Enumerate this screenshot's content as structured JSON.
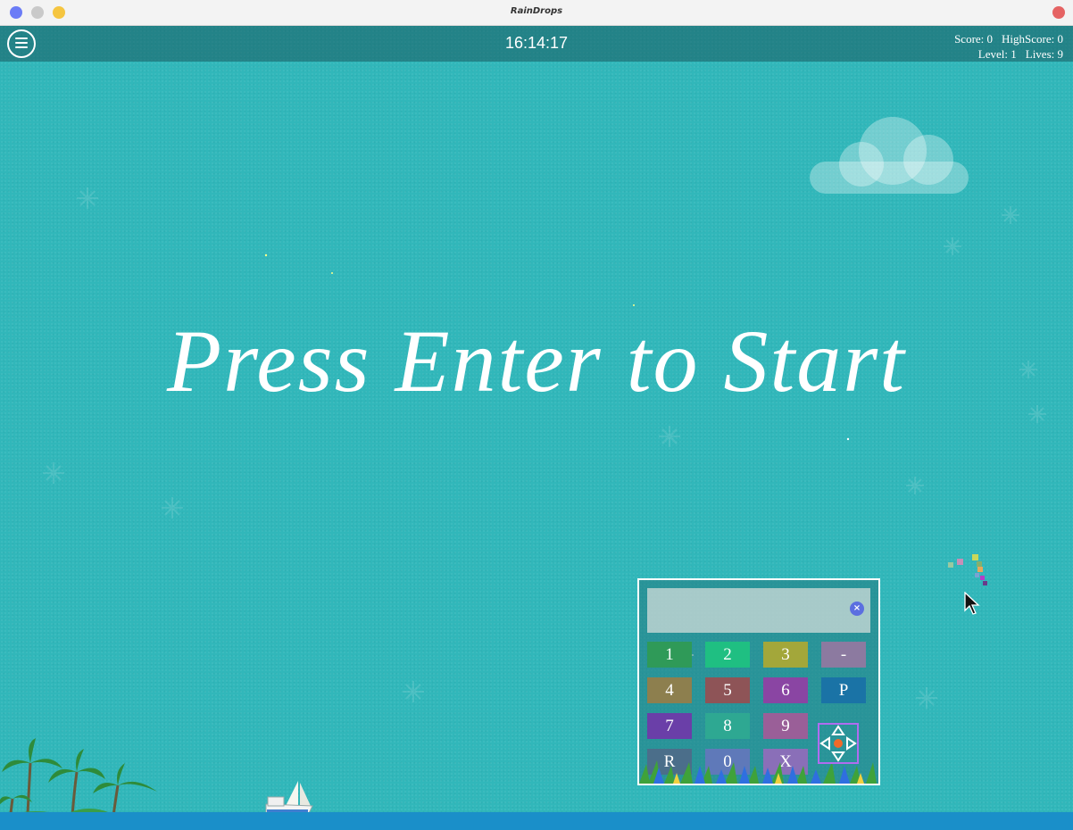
{
  "window": {
    "title": "RainDrops"
  },
  "hud": {
    "clock": "16:14:17",
    "score_label": "Score: 0",
    "highscore_label": "HighScore: 0",
    "level_label": "Level: 1",
    "lives_label": "Lives: 9"
  },
  "headline": "Press Enter to Start",
  "keypad": {
    "keys": [
      {
        "label": "1",
        "color": "#2f9a58"
      },
      {
        "label": "2",
        "color": "#1fbf82"
      },
      {
        "label": "3",
        "color": "#a3a73a"
      },
      {
        "label": "-",
        "color": "#8c7aa0"
      },
      {
        "label": "4",
        "color": "#8d7f4e"
      },
      {
        "label": "5",
        "color": "#8e5457"
      },
      {
        "label": "6",
        "color": "#8a45a3"
      },
      {
        "label": "P",
        "color": "#1a73a6"
      },
      {
        "label": "7",
        "color": "#6a3fa8"
      },
      {
        "label": "8",
        "color": "#2ea892"
      },
      {
        "label": "9",
        "color": "#9a5f98"
      },
      {
        "label": "R",
        "color": "#4b6e8a"
      },
      {
        "label": "0",
        "color": "#5f79b9"
      },
      {
        "label": "X",
        "color": "#8a6fb8"
      }
    ]
  },
  "colors": {
    "game_background": "#31b7ba",
    "hud_bar": "#2b7f82",
    "water": "#1a8fc9",
    "text": "#ffffff"
  }
}
